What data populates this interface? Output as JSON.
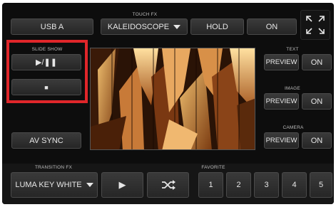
{
  "top": {
    "source_label": "USB A",
    "touch_fx_heading": "TOUCH FX",
    "touch_fx_value": "KALEIDOSCOPE",
    "hold_label": "HOLD",
    "on_label": "ON"
  },
  "slideshow": {
    "heading": "SLIDE SHOW",
    "play_pause_label": "▶/❚❚",
    "stop_label": "■"
  },
  "av_sync_label": "AV SYNC",
  "overlays": {
    "text": {
      "heading": "TEXT",
      "preview_label": "PREVIEW",
      "on_label": "ON"
    },
    "image": {
      "heading": "IMAGE",
      "preview_label": "PREVIEW",
      "on_label": "ON"
    },
    "camera": {
      "heading": "CAMERA",
      "preview_label": "PREVIEW",
      "on_label": "ON"
    }
  },
  "transition": {
    "heading": "TRANSITION FX",
    "value": "LUMA KEY WHITE",
    "play_label": "▶",
    "shuffle_label": "⤮"
  },
  "favorite": {
    "heading": "FAVORITE",
    "slots": [
      "1",
      "2",
      "3",
      "4",
      "5"
    ]
  },
  "colors": {
    "highlight": "#e0262a",
    "panel": "#0d0d0d",
    "button": "#303030"
  },
  "icons": {
    "fullscreen": "expand-arrows-icon",
    "shuffle": "shuffle-icon"
  }
}
